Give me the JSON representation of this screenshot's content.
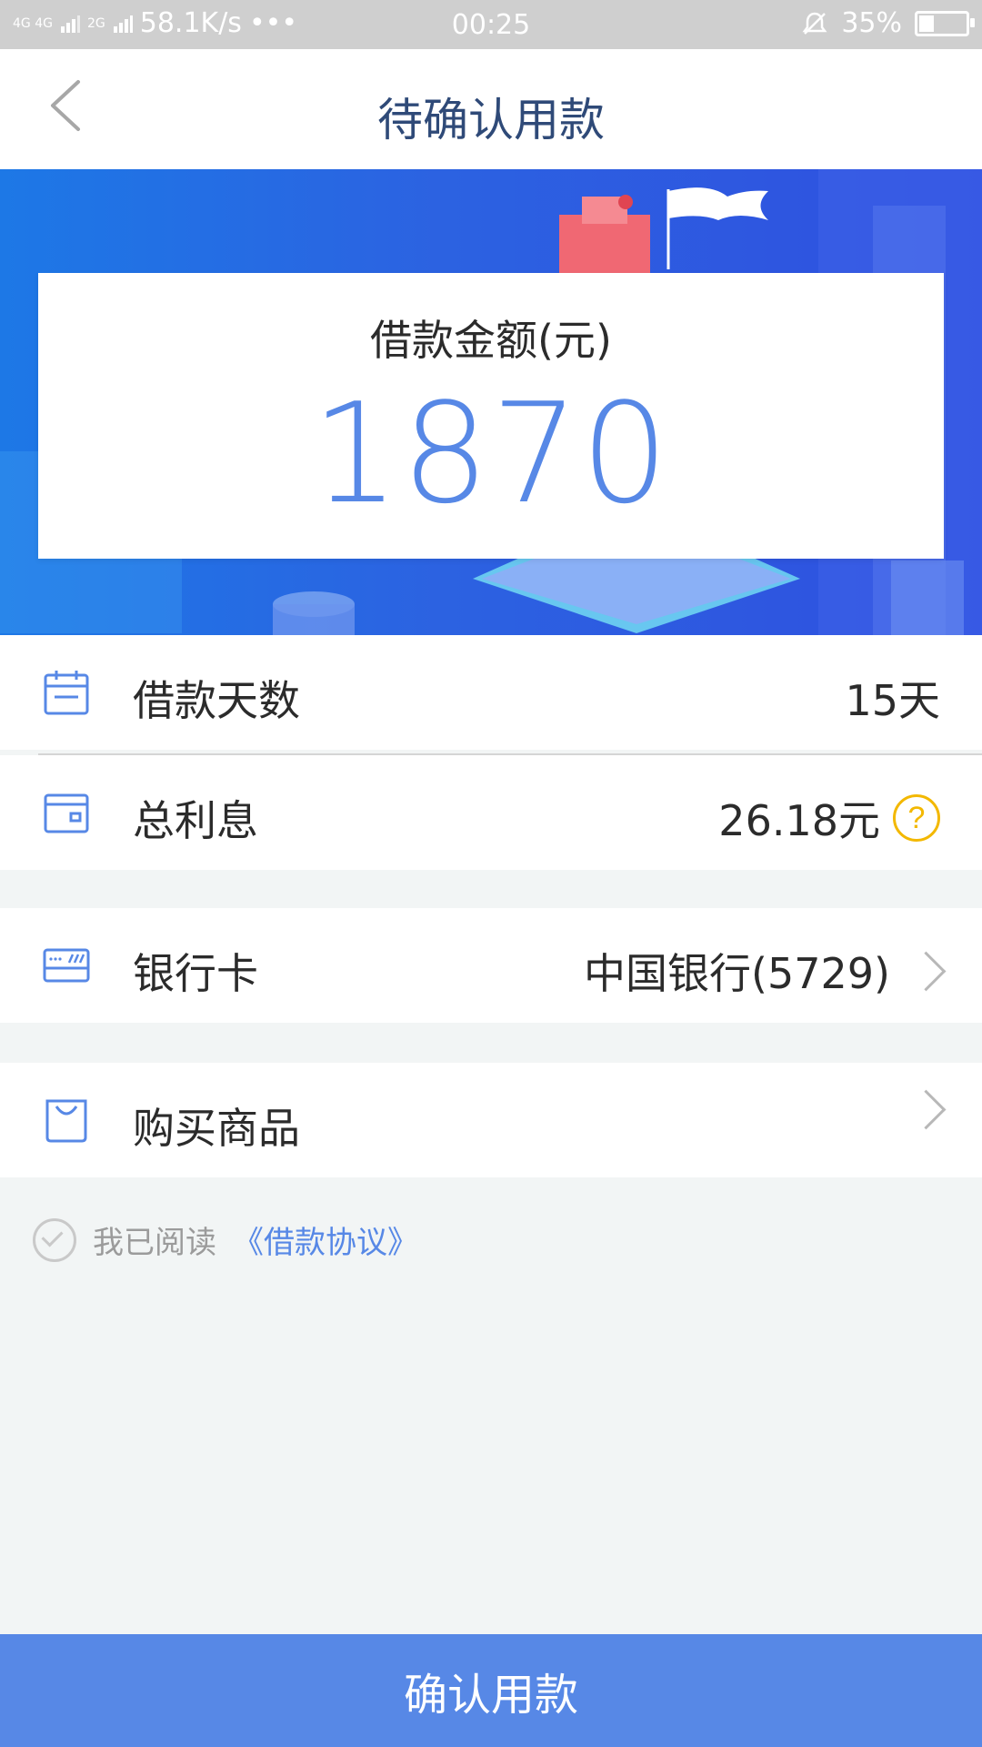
{
  "status_bar": {
    "net_1": "4G 4G",
    "net_2": "2G",
    "speed": "58.1K/s",
    "more": "•••",
    "time": "00:25",
    "battery": "35%"
  },
  "header": {
    "title": "待确认用款"
  },
  "amount": {
    "label": "借款金额(元)",
    "value": "1870"
  },
  "rows": {
    "days": {
      "label": "借款天数",
      "value": "15天",
      "icon": "calendar-icon"
    },
    "interest": {
      "label": "总利息",
      "value": "26.18元",
      "help": "?",
      "icon": "wallet-icon"
    },
    "bank": {
      "label": "银行卡",
      "value": "中国银行(5729)",
      "icon": "credit-card-icon"
    },
    "goods": {
      "label": "购买商品",
      "value": "",
      "icon": "shopping-bag-icon"
    }
  },
  "agreement": {
    "text": "我已阅读",
    "link": "《借款协议》"
  },
  "footer": {
    "confirm_label": "确认用款"
  },
  "colors": {
    "accent": "#5788e6",
    "header_title": "#2f4a78",
    "warning": "#f3b800",
    "hero_start": "#1d78e6",
    "hero_end": "#2f4fe0"
  }
}
